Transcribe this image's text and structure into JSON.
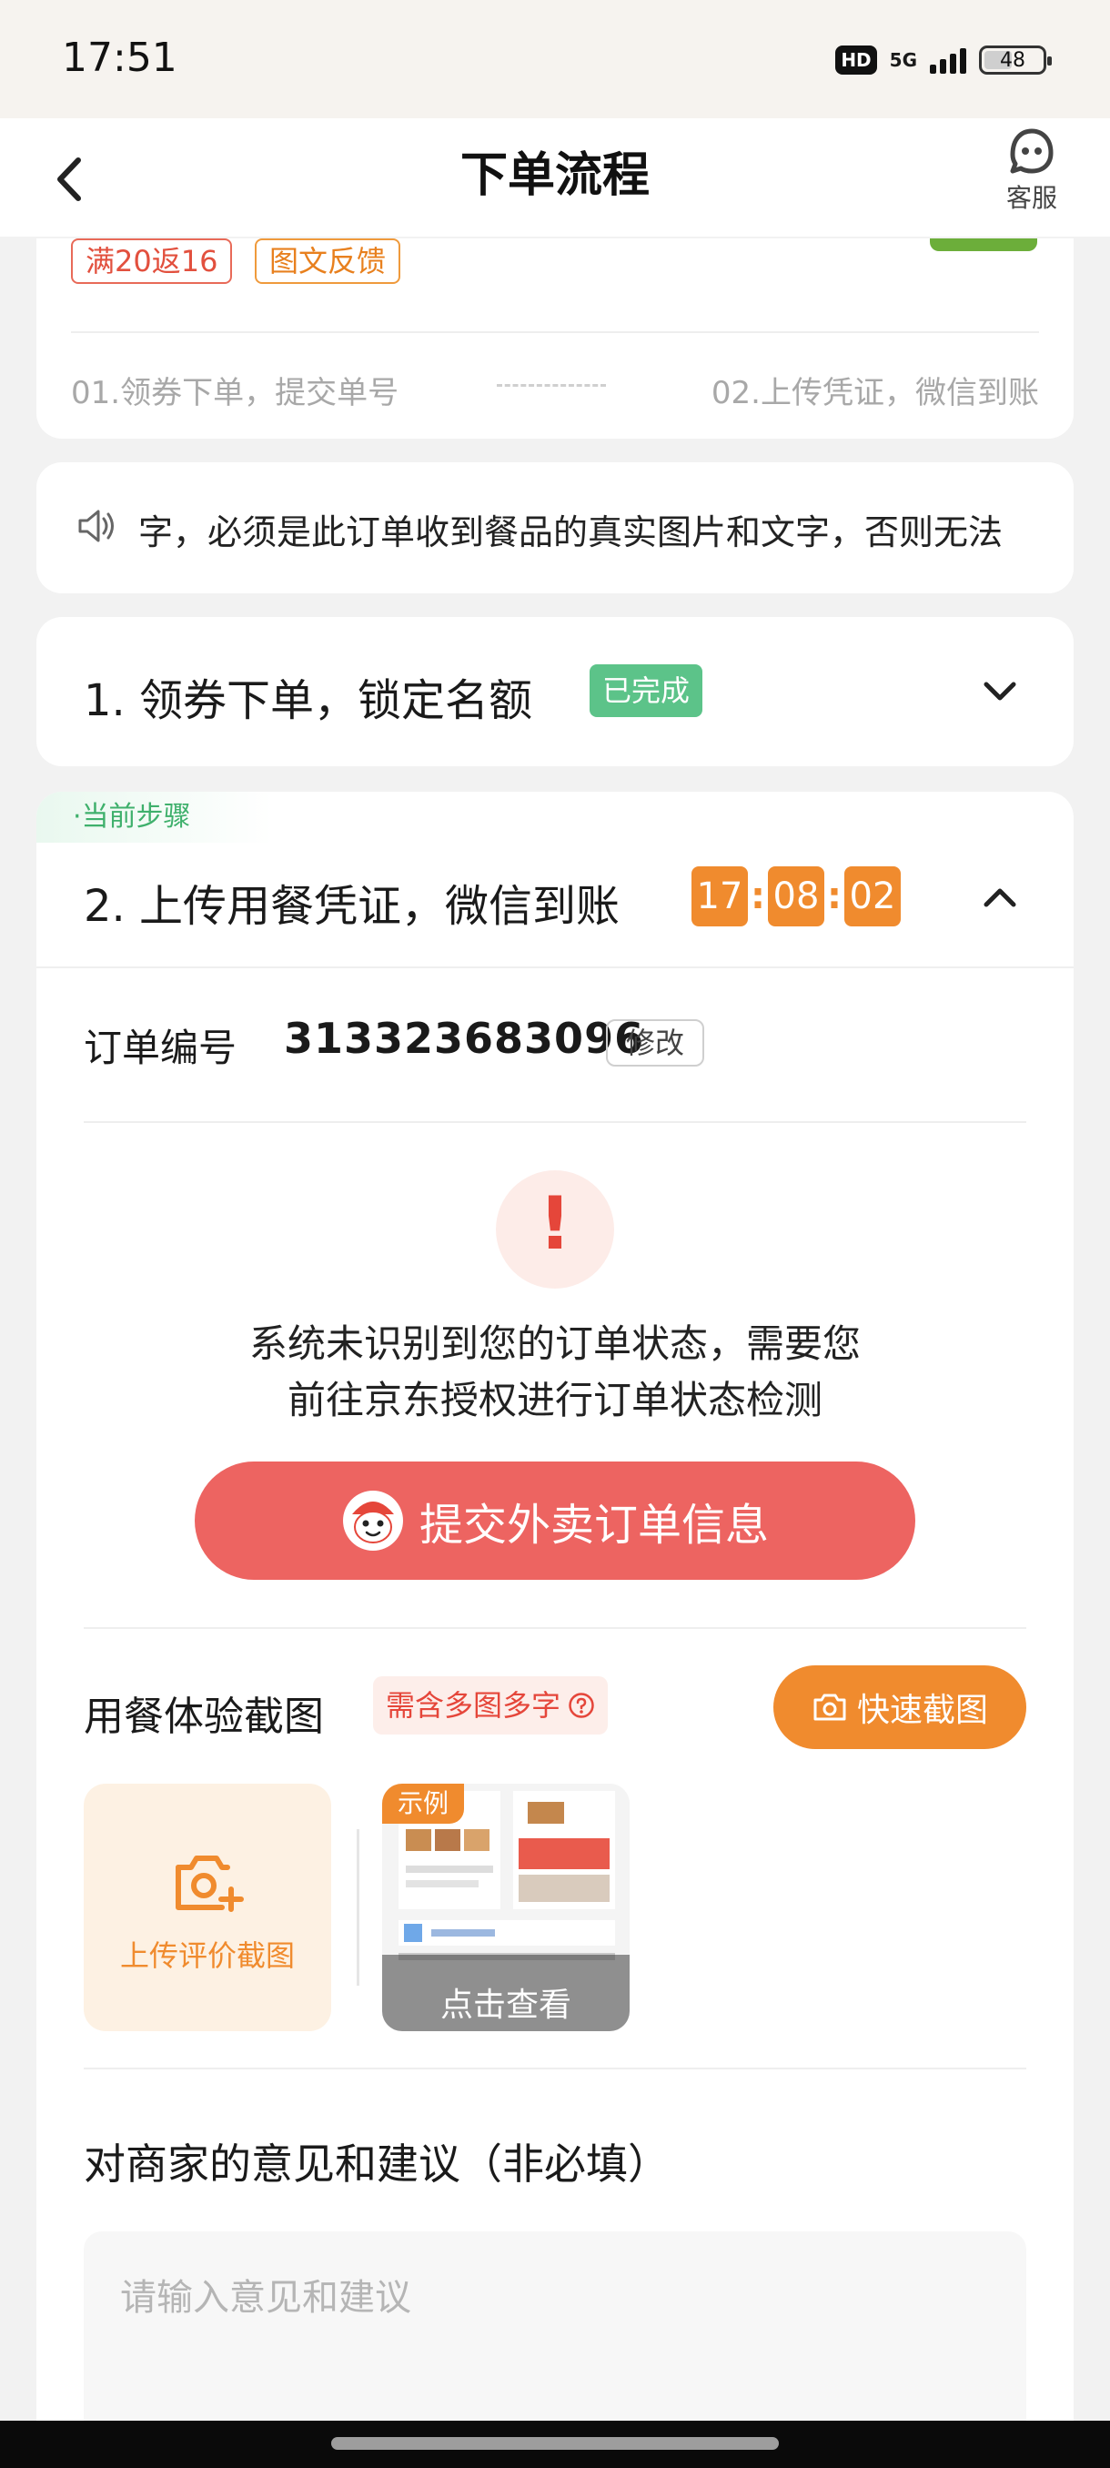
{
  "status_bar": {
    "time": "17:51",
    "hd": "HD",
    "network": "5G",
    "battery": "48",
    "battery_level": 0.48
  },
  "header": {
    "title": "下单流程",
    "service_label": "客服"
  },
  "summary": {
    "tags": [
      "满20返16",
      "图文反馈"
    ],
    "steps": [
      "01.领券下单，提交单号",
      "02.上传凭证，微信到账"
    ]
  },
  "notice": {
    "text": "字，必须是此订单收到餐品的真实图片和文字，否则无法"
  },
  "step1": {
    "title": "1. 领券下单，锁定名额",
    "status": "已完成"
  },
  "step2": {
    "current_label": "·当前步骤",
    "title": "2. 上传用餐凭证，微信到账",
    "timer": [
      "17",
      "08",
      "02"
    ],
    "order_label": "订单编号",
    "order_number": "313323683096",
    "edit_label": "修改",
    "alert_mark": "!",
    "alert_line1": "系统未识别到您的订单状态，需要您",
    "alert_line2": "前往京东授权进行订单状态检测",
    "submit_label": "提交外卖订单信息",
    "screenshot_title": "用餐体验截图",
    "screenshot_hint": "需含多图多字",
    "quick_label": "快速截图",
    "upload_label": "上传评价截图",
    "example_tag": "示例",
    "example_view": "点击查看",
    "advice_title": "对商家的意见和建议（非必填）",
    "advice_placeholder": "请输入意见和建议"
  },
  "colors": {
    "accent_orange": "#f08b2e",
    "submit_red": "#ed6461",
    "done_green": "#5cc389",
    "alert_red": "#e5463a"
  },
  "icons": [
    "back-icon",
    "customer-service-icon",
    "speaker-icon",
    "chevron-down-icon",
    "chevron-up-icon",
    "joy-mascot-icon",
    "help-icon",
    "camera-icon",
    "camera-plus-icon"
  ]
}
